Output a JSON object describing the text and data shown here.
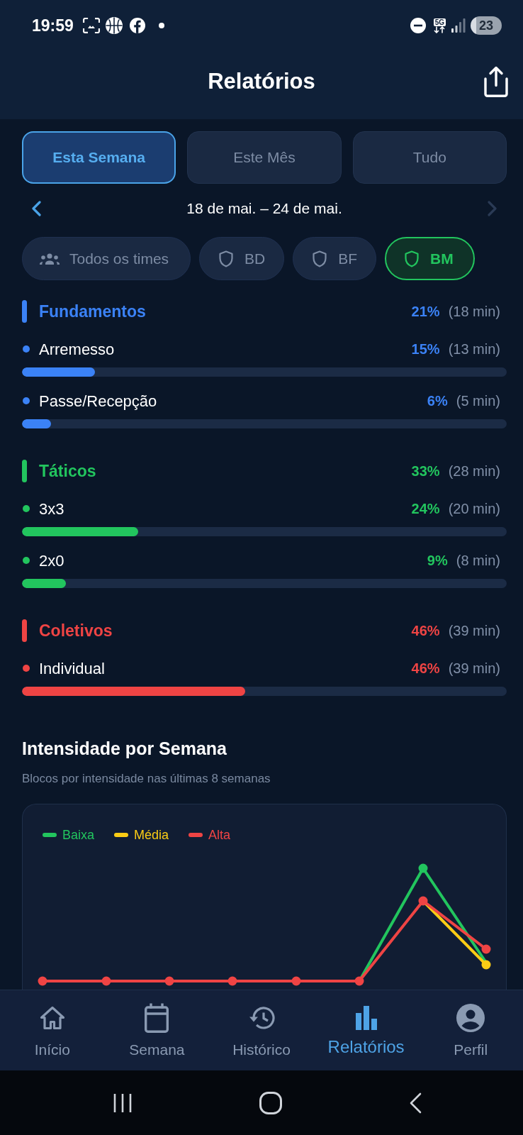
{
  "status_bar": {
    "time": "19:59",
    "network": "5G",
    "battery": "23"
  },
  "header": {
    "title": "Relatórios"
  },
  "period_tabs": [
    {
      "label": "Esta Semana",
      "selected": true
    },
    {
      "label": "Este Mês",
      "selected": false
    },
    {
      "label": "Tudo",
      "selected": false
    }
  ],
  "date_range": {
    "label": "18 de mai. – 24 de mai.",
    "previous_disabled": false,
    "next_disabled": true
  },
  "team_filters": [
    {
      "label": "Todos os times",
      "kind": "all",
      "selected": false
    },
    {
      "label": "BD",
      "kind": "team",
      "selected": false
    },
    {
      "label": "BF",
      "kind": "team",
      "selected": false
    },
    {
      "label": "BM",
      "kind": "team",
      "selected": true
    }
  ],
  "categories": [
    {
      "name": "Fundamentos",
      "color": "#3b82f6",
      "percent": "21%",
      "duration": "(18 min)",
      "items": [
        {
          "name": "Arremesso",
          "percent": "15%",
          "duration": "(13 min)",
          "level": 0.15
        },
        {
          "name": "Passe/Recepção",
          "percent": "6%",
          "duration": "(5 min)",
          "level": 0.06
        }
      ]
    },
    {
      "name": "Táticos",
      "color": "#22c55e",
      "percent": "33%",
      "duration": "(28 min)",
      "items": [
        {
          "name": "3x3",
          "percent": "24%",
          "duration": "(20 min)",
          "level": 0.24
        },
        {
          "name": "2x0",
          "percent": "9%",
          "duration": "(8 min)",
          "level": 0.09
        }
      ]
    },
    {
      "name": "Coletivos",
      "color": "#ef4444",
      "percent": "46%",
      "duration": "(39 min)",
      "items": [
        {
          "name": "Individual",
          "percent": "46%",
          "duration": "(39 min)",
          "level": 0.46
        }
      ]
    }
  ],
  "intensity": {
    "title": "Intensidade por Semana",
    "subtitle": "Blocos por intensidade nas últimas 8 semanas",
    "legend": [
      {
        "label": "Baixa",
        "color": "#22c55e"
      },
      {
        "label": "Média",
        "color": "#facc15"
      },
      {
        "label": "Alta",
        "color": "#ef4444"
      }
    ]
  },
  "bottom_nav": [
    {
      "label": "Início",
      "selected": false
    },
    {
      "label": "Semana",
      "selected": false
    },
    {
      "label": "Histórico",
      "selected": false
    },
    {
      "label": "Relatórios",
      "selected": true
    },
    {
      "label": "Perfil",
      "selected": false
    }
  ]
}
